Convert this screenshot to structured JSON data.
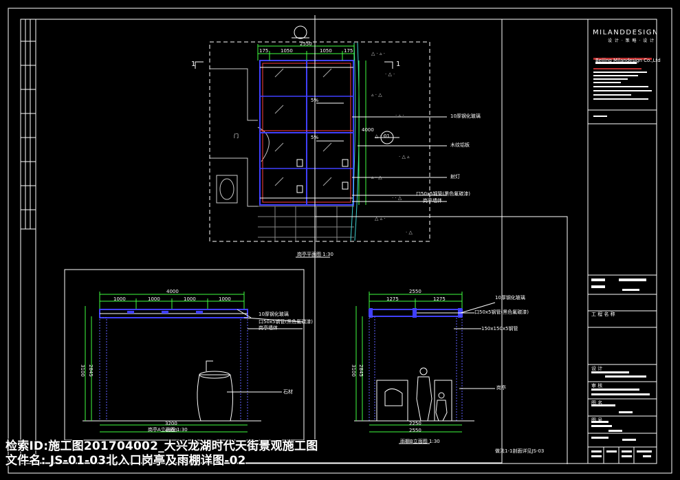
{
  "drawing": {
    "company_logo": "MILANDDESIGN",
    "company_logo_sub": "设 计 · 策 略 · 设 计",
    "company_name_en": "Beijing Milandesign Co.,Ltd",
    "plan_title": "岗亭平面图  1:30",
    "elevation_a_title": "岗亭A立面图  1:30",
    "elevation_b_title": "雨棚B立面图  1:30",
    "section_note": "做法1-1剖面详见JS-03",
    "section_marker": "1",
    "detail_marker": "01",
    "dims": {
      "plan_total": "2550",
      "plan_segments": [
        "175",
        "1050",
        "1050",
        "175"
      ],
      "plan_height": "4000",
      "elev_a_total": "4000",
      "elev_a_segments": [
        "1000",
        "1000",
        "1000",
        "1000"
      ],
      "elev_a_bottom": "3200",
      "elev_a_bottom_total": "4000",
      "elev_a_height": "3100",
      "elev_a_height_inner": "2845",
      "elev_b_total": "2550",
      "elev_b_segments": [
        "1275",
        "1275"
      ],
      "elev_b_bottom": "2250",
      "elev_b_bottom_total": "2550",
      "elev_b_height": "3100",
      "elev_b_height_inner": "2845",
      "slope_label": "5%"
    },
    "annotations": {
      "glass": "10厚钢化玻璃",
      "steel_1": "口50x5钢管(黑色氟碳漆)",
      "steel_2": "150x150x5钢管",
      "wall": "岗亭墙体",
      "light": "射灯",
      "door": "门",
      "guard": "岗亭",
      "wood": "木纹铝板",
      "stone": "石材"
    }
  },
  "title_block": {
    "project_label": "工 程 名 称",
    "design_label": "设 计",
    "check_label": "审 核",
    "drawing_label": "图 名",
    "number_label": "图 号"
  },
  "caption": {
    "line1": "检索ID:施工图201704002_大兴龙湖时代天街景观施工图",
    "line2": "文件名:  JS-01-03北入口岗亭及雨棚详图-02"
  }
}
